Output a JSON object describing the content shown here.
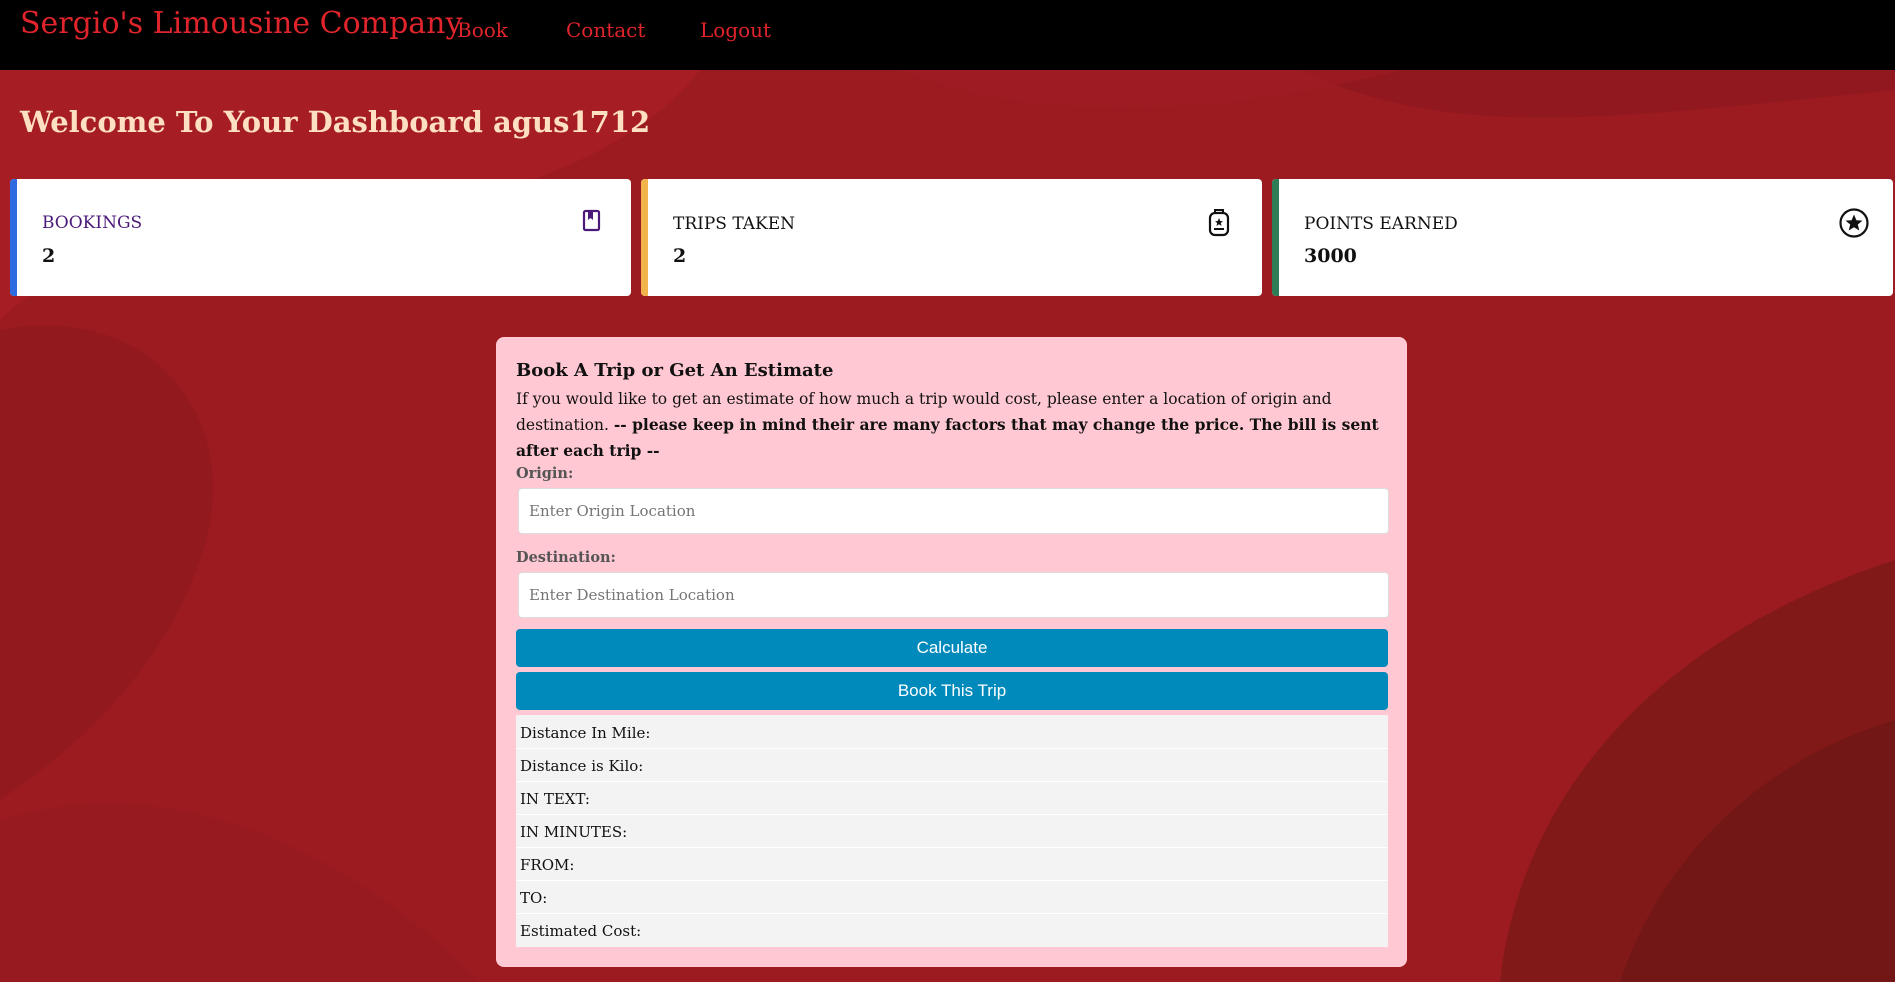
{
  "colors": {
    "brand_red": "#e0242b",
    "background_red": "#9c1b21",
    "welcome_text": "#fde0c2",
    "panel_bg": "#ffc8d2",
    "button_blue": "#0089bb",
    "bookings_accent": "#2f6be0",
    "trips_accent": "#f2b44a",
    "points_accent": "#2e7d57",
    "bookings_label": "#4b1a78"
  },
  "navbar": {
    "brand": "Sergio's Limousine Company",
    "links": [
      "Book",
      "Contact",
      "Logout"
    ]
  },
  "welcome": "Welcome To Your Dashboard agus1712",
  "cards": [
    {
      "label": "BOOKINGS",
      "value": "2",
      "icon": "bookmark-icon"
    },
    {
      "label": "TRIPS TAKEN",
      "value": "2",
      "icon": "luggage-icon"
    },
    {
      "label": "POINTS EARNED",
      "value": "3000",
      "icon": "star-circle-icon"
    }
  ],
  "booking": {
    "title": "Book A Trip or Get An Estimate",
    "description": "If you would like to get an estimate of how much a trip would cost, please enter a location of origin and destination.",
    "note": "-- please keep in mind their are many factors that may change the price. The bill is sent after each trip --",
    "origin_label": "Origin:",
    "origin_placeholder": "Enter Origin Location",
    "destination_label": "Destination:",
    "destination_placeholder": "Enter Destination Location",
    "calculate_label": "Calculate",
    "book_label": "Book This Trip",
    "results": [
      "Distance In Mile:",
      "Distance is Kilo:",
      "IN TEXT:",
      "IN MINUTES:",
      "FROM:",
      "TO:",
      "Estimated Cost:"
    ]
  }
}
